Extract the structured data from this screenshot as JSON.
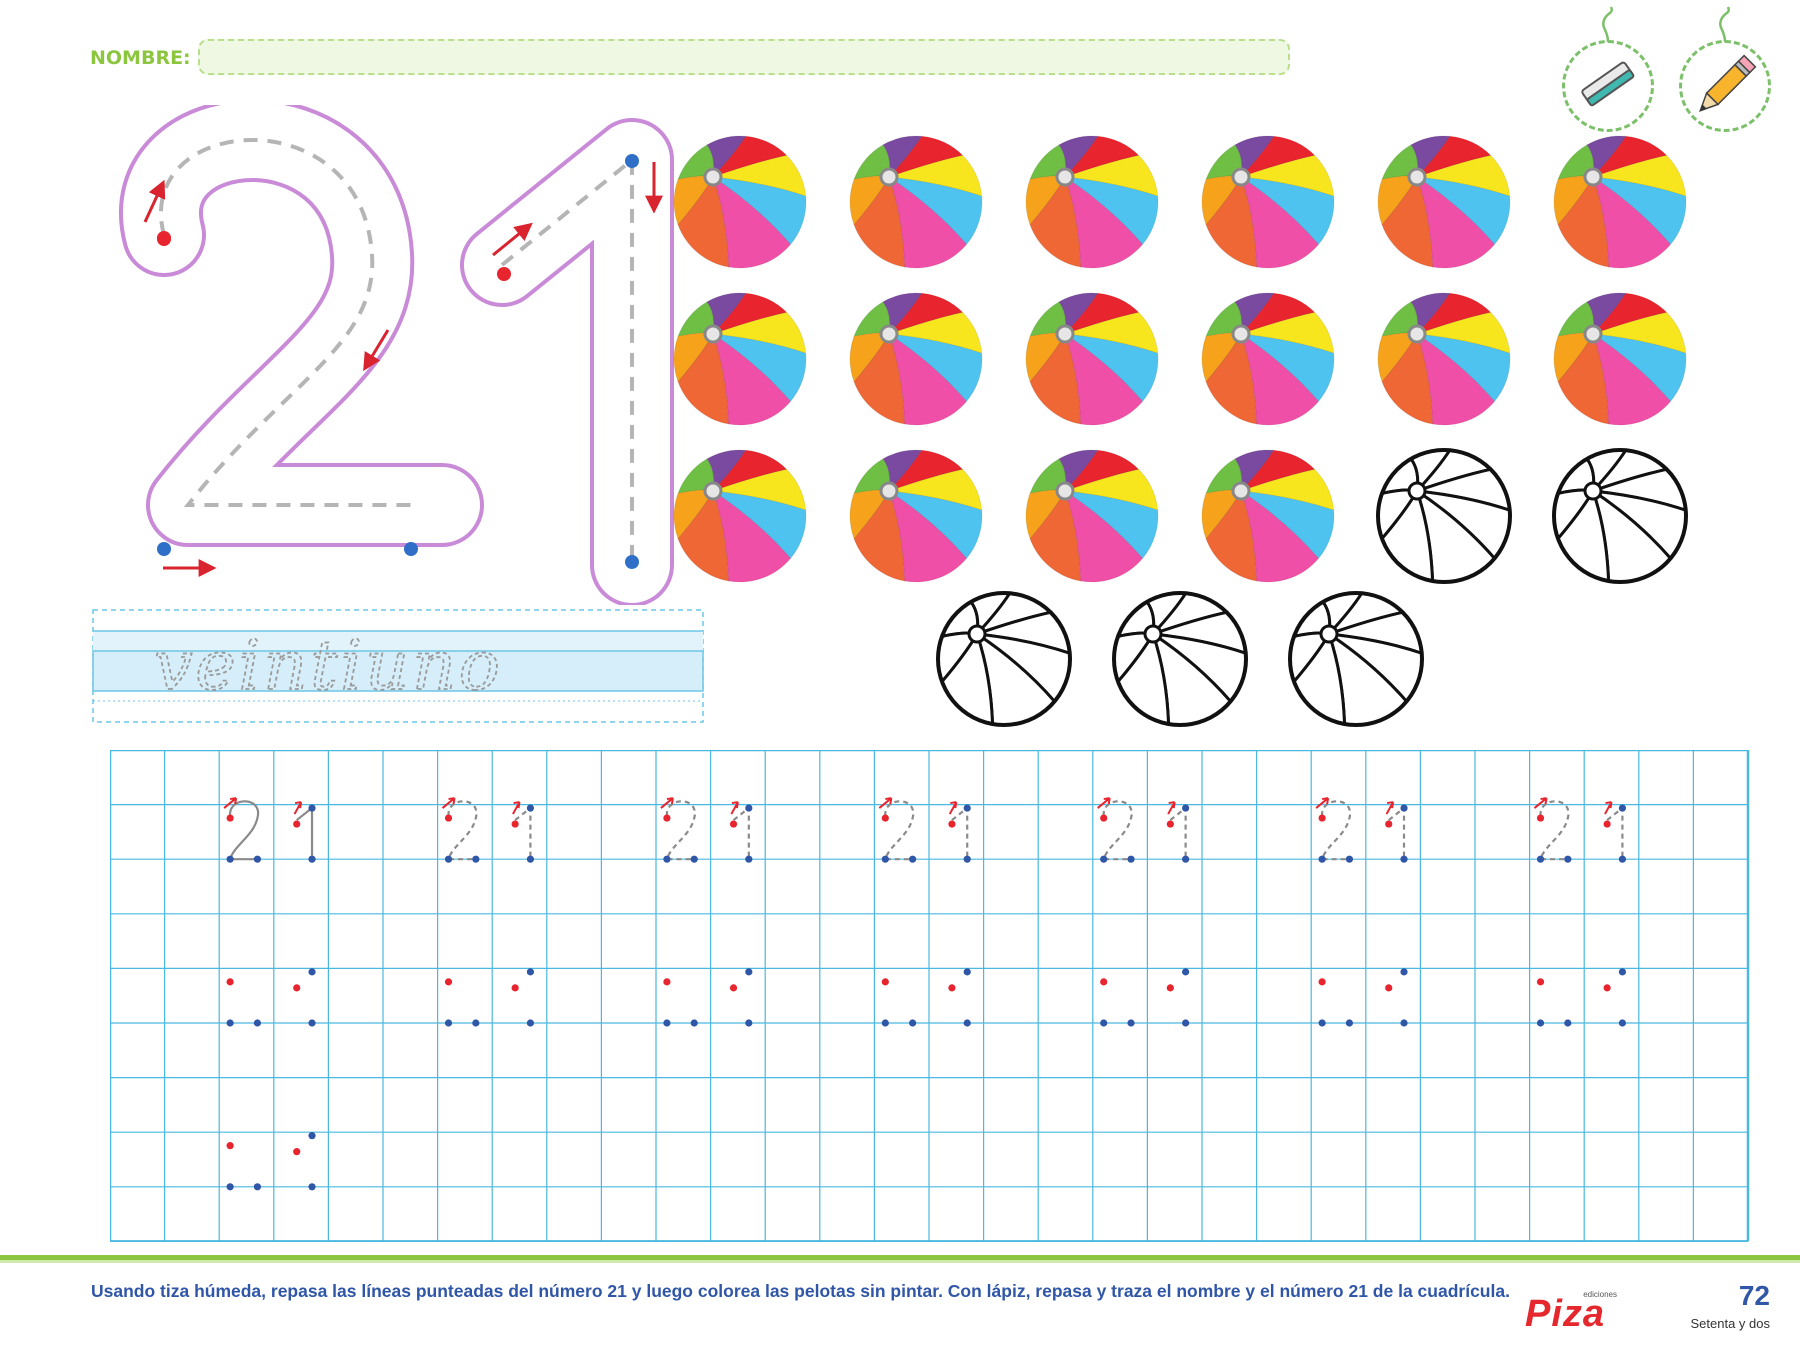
{
  "header": {
    "name_label": "NOMBRE:",
    "tools": [
      {
        "name": "chalk",
        "icon": "chalk-icon"
      },
      {
        "name": "pencil",
        "icon": "pencil-icon"
      }
    ]
  },
  "number": {
    "digits": "21",
    "word": "veintiuno"
  },
  "balls": {
    "colored_count": 16,
    "uncolored_count": 5,
    "total": 21,
    "colors": [
      "#f04fa8",
      "#4ec3f0",
      "#f7e51d",
      "#ef6735",
      "#f7a21b",
      "#6fbf44",
      "#7a4aa0",
      "#e8242e"
    ]
  },
  "practice_grid": {
    "rows": [
      {
        "label": "21",
        "repeats": 7,
        "style": "solid-then-dashed"
      },
      {
        "label": "21",
        "repeats": 7,
        "style": "dots-only"
      },
      {
        "label": "21",
        "repeats": 1,
        "style": "dots-only"
      }
    ],
    "grid_color": "#4ab8e0",
    "start_dot_color": "#e8242e",
    "end_dot_color": "#2f56a7"
  },
  "footer": {
    "instructions": "Usando tiza húmeda, repasa las líneas punteadas del número 21 y luego colorea las pelotas sin pintar. Con lápiz, repasa y traza el nombre y el número 21 de la cuadrícula.",
    "publisher_edition": "ediciones",
    "publisher_name": "Piza",
    "page_number": "72",
    "page_words": "Setenta y dos"
  }
}
